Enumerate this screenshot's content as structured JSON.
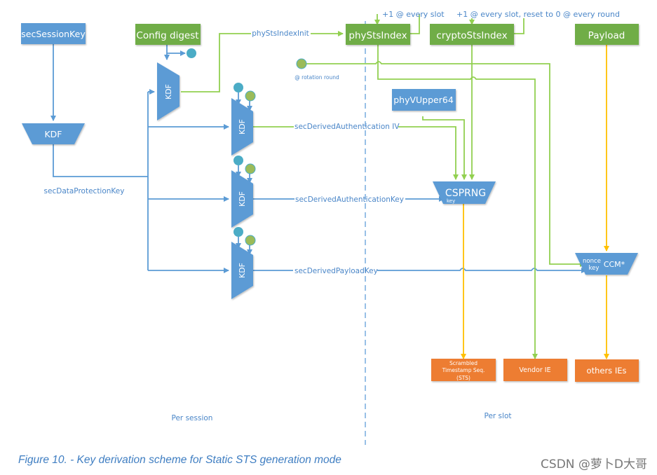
{
  "colors": {
    "blue": "#5b9bd5",
    "green": "#70ad47",
    "light_green": "#92d050",
    "orange": "#ed7d31",
    "yellow": "#ffc000",
    "teal": "#4bacc6",
    "olive": "#9bbb59",
    "label_blue": "#4a86c8"
  },
  "nodes": {
    "sec_session_key": "secSessionKey",
    "config_digest": "Config digest",
    "phy_sts_index": "phyStsIndex",
    "crypto_sts_index": "cryptoStsIndex",
    "payload": "Payload",
    "phy_v_upper64": "phyVUpper64",
    "kdf_main": "KDF",
    "kdf_config": "KDF",
    "kdf_iv": "KDF",
    "kdf_auth_key": "KDF",
    "kdf_payload": "KDF",
    "csprng": "CSPRNG",
    "csprng_key_port": "key",
    "ccm": "CCM*",
    "ccm_nonce_port": "nonce",
    "ccm_key_port": "key",
    "sts_output_line1": "Scrambled",
    "sts_output_line2": "Timestamp Seq.",
    "sts_output_line3": "(STS)",
    "vendor_ie": "Vendor IE",
    "other_ies": "others IEs"
  },
  "edge_labels": {
    "phy_sts_index_init": "phyStsIndexInit",
    "phy_sts_index_increment": "+1 @ every slot",
    "crypto_sts_index_increment": "+1 @ every slot, reset to 0 @ every round",
    "rotation_round": "@ rotation round",
    "sec_data_protection_key": "secDataProtectionKey",
    "sec_derived_auth_iv": "secDerivedAuthentication IV",
    "sec_derived_auth_key": "secDerivedAuthenticationKey",
    "sec_derived_payload_key": "secDerivedPayloadKey"
  },
  "regions": {
    "per_session": "Per session",
    "per_slot": "Per slot"
  },
  "caption": "Figure 10. - Key derivation scheme for Static STS generation mode",
  "watermark": "CSDN @萝卜D大哥"
}
